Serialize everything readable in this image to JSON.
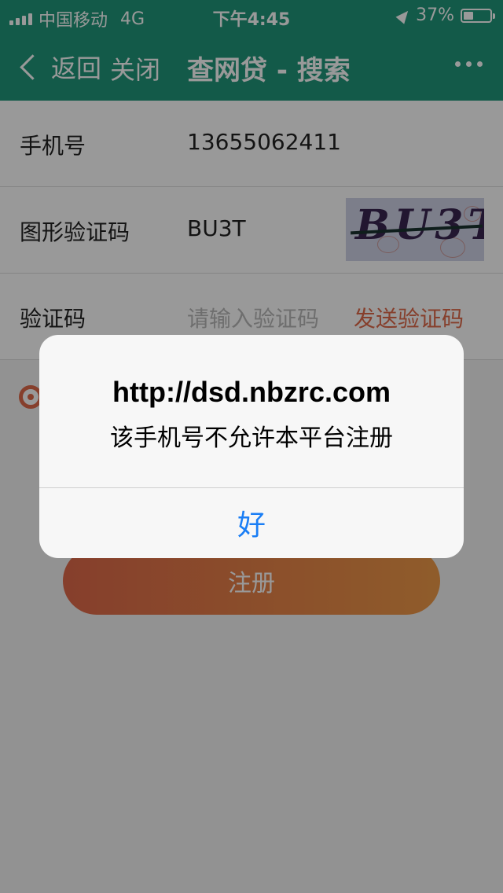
{
  "status_bar": {
    "carrier": "中国移动",
    "network": "4G",
    "time": "下午4:45",
    "battery_percent": "37%",
    "battery_level": 0.37
  },
  "nav": {
    "back_label": "返回",
    "close_label": "关闭",
    "title": "查网贷 - 搜索"
  },
  "form": {
    "phone_label": "手机号",
    "phone_value": "13655062411",
    "captcha_label": "图形验证码",
    "captcha_value": "BU3T",
    "captcha_image_text": "BU3T",
    "code_label": "验证码",
    "code_placeholder": "请输入验证码",
    "send_code_label": "发送验证码"
  },
  "register_button": "注册",
  "alert": {
    "title": "http://dsd.nbzrc.com",
    "message": "该手机号不允许本平台注册",
    "ok_label": "好"
  },
  "colors": {
    "header_bg": "#21977a",
    "accent": "#e06a4a",
    "link_blue": "#1a7ef5"
  }
}
